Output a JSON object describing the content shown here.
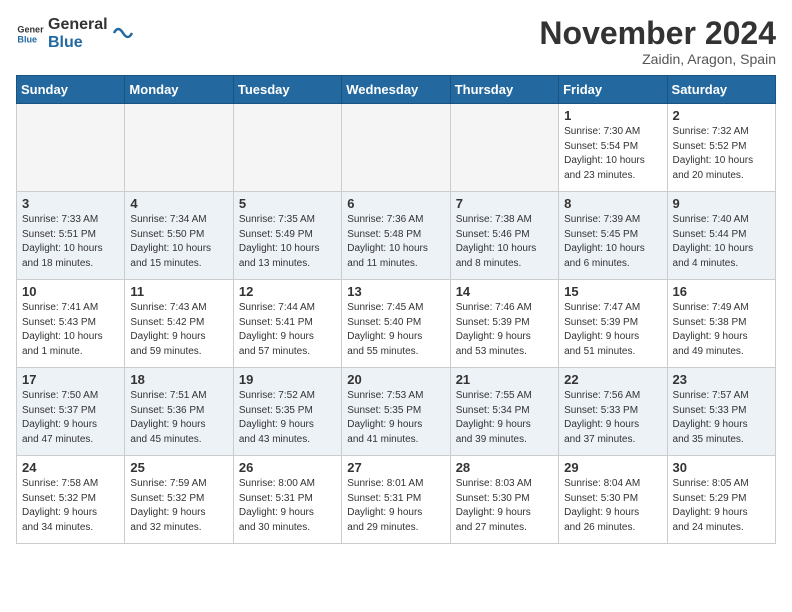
{
  "header": {
    "logo_line1": "General",
    "logo_line2": "Blue",
    "month": "November 2024",
    "location": "Zaidin, Aragon, Spain"
  },
  "weekdays": [
    "Sunday",
    "Monday",
    "Tuesday",
    "Wednesday",
    "Thursday",
    "Friday",
    "Saturday"
  ],
  "weeks": [
    [
      {
        "day": "",
        "info": ""
      },
      {
        "day": "",
        "info": ""
      },
      {
        "day": "",
        "info": ""
      },
      {
        "day": "",
        "info": ""
      },
      {
        "day": "",
        "info": ""
      },
      {
        "day": "1",
        "info": "Sunrise: 7:30 AM\nSunset: 5:54 PM\nDaylight: 10 hours\nand 23 minutes."
      },
      {
        "day": "2",
        "info": "Sunrise: 7:32 AM\nSunset: 5:52 PM\nDaylight: 10 hours\nand 20 minutes."
      }
    ],
    [
      {
        "day": "3",
        "info": "Sunrise: 7:33 AM\nSunset: 5:51 PM\nDaylight: 10 hours\nand 18 minutes."
      },
      {
        "day": "4",
        "info": "Sunrise: 7:34 AM\nSunset: 5:50 PM\nDaylight: 10 hours\nand 15 minutes."
      },
      {
        "day": "5",
        "info": "Sunrise: 7:35 AM\nSunset: 5:49 PM\nDaylight: 10 hours\nand 13 minutes."
      },
      {
        "day": "6",
        "info": "Sunrise: 7:36 AM\nSunset: 5:48 PM\nDaylight: 10 hours\nand 11 minutes."
      },
      {
        "day": "7",
        "info": "Sunrise: 7:38 AM\nSunset: 5:46 PM\nDaylight: 10 hours\nand 8 minutes."
      },
      {
        "day": "8",
        "info": "Sunrise: 7:39 AM\nSunset: 5:45 PM\nDaylight: 10 hours\nand 6 minutes."
      },
      {
        "day": "9",
        "info": "Sunrise: 7:40 AM\nSunset: 5:44 PM\nDaylight: 10 hours\nand 4 minutes."
      }
    ],
    [
      {
        "day": "10",
        "info": "Sunrise: 7:41 AM\nSunset: 5:43 PM\nDaylight: 10 hours\nand 1 minute."
      },
      {
        "day": "11",
        "info": "Sunrise: 7:43 AM\nSunset: 5:42 PM\nDaylight: 9 hours\nand 59 minutes."
      },
      {
        "day": "12",
        "info": "Sunrise: 7:44 AM\nSunset: 5:41 PM\nDaylight: 9 hours\nand 57 minutes."
      },
      {
        "day": "13",
        "info": "Sunrise: 7:45 AM\nSunset: 5:40 PM\nDaylight: 9 hours\nand 55 minutes."
      },
      {
        "day": "14",
        "info": "Sunrise: 7:46 AM\nSunset: 5:39 PM\nDaylight: 9 hours\nand 53 minutes."
      },
      {
        "day": "15",
        "info": "Sunrise: 7:47 AM\nSunset: 5:39 PM\nDaylight: 9 hours\nand 51 minutes."
      },
      {
        "day": "16",
        "info": "Sunrise: 7:49 AM\nSunset: 5:38 PM\nDaylight: 9 hours\nand 49 minutes."
      }
    ],
    [
      {
        "day": "17",
        "info": "Sunrise: 7:50 AM\nSunset: 5:37 PM\nDaylight: 9 hours\nand 47 minutes."
      },
      {
        "day": "18",
        "info": "Sunrise: 7:51 AM\nSunset: 5:36 PM\nDaylight: 9 hours\nand 45 minutes."
      },
      {
        "day": "19",
        "info": "Sunrise: 7:52 AM\nSunset: 5:35 PM\nDaylight: 9 hours\nand 43 minutes."
      },
      {
        "day": "20",
        "info": "Sunrise: 7:53 AM\nSunset: 5:35 PM\nDaylight: 9 hours\nand 41 minutes."
      },
      {
        "day": "21",
        "info": "Sunrise: 7:55 AM\nSunset: 5:34 PM\nDaylight: 9 hours\nand 39 minutes."
      },
      {
        "day": "22",
        "info": "Sunrise: 7:56 AM\nSunset: 5:33 PM\nDaylight: 9 hours\nand 37 minutes."
      },
      {
        "day": "23",
        "info": "Sunrise: 7:57 AM\nSunset: 5:33 PM\nDaylight: 9 hours\nand 35 minutes."
      }
    ],
    [
      {
        "day": "24",
        "info": "Sunrise: 7:58 AM\nSunset: 5:32 PM\nDaylight: 9 hours\nand 34 minutes."
      },
      {
        "day": "25",
        "info": "Sunrise: 7:59 AM\nSunset: 5:32 PM\nDaylight: 9 hours\nand 32 minutes."
      },
      {
        "day": "26",
        "info": "Sunrise: 8:00 AM\nSunset: 5:31 PM\nDaylight: 9 hours\nand 30 minutes."
      },
      {
        "day": "27",
        "info": "Sunrise: 8:01 AM\nSunset: 5:31 PM\nDaylight: 9 hours\nand 29 minutes."
      },
      {
        "day": "28",
        "info": "Sunrise: 8:03 AM\nSunset: 5:30 PM\nDaylight: 9 hours\nand 27 minutes."
      },
      {
        "day": "29",
        "info": "Sunrise: 8:04 AM\nSunset: 5:30 PM\nDaylight: 9 hours\nand 26 minutes."
      },
      {
        "day": "30",
        "info": "Sunrise: 8:05 AM\nSunset: 5:29 PM\nDaylight: 9 hours\nand 24 minutes."
      }
    ]
  ]
}
